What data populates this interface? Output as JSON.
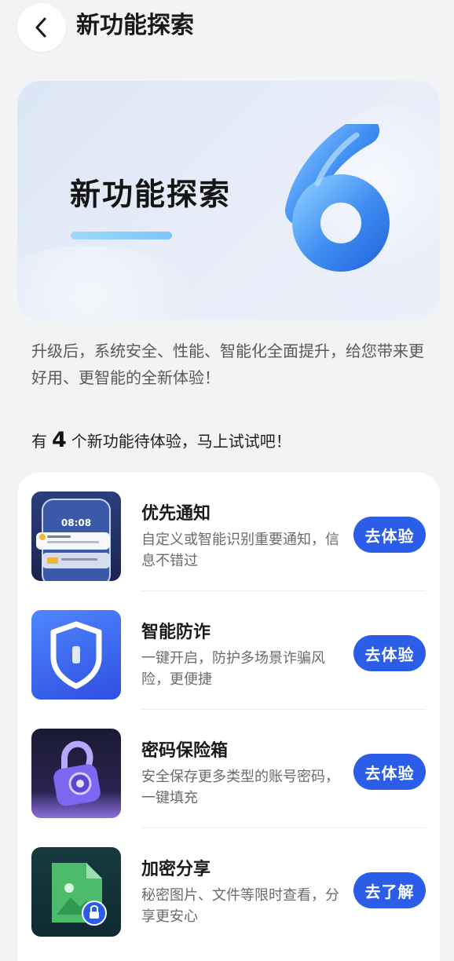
{
  "header": {
    "title": "新功能探索"
  },
  "banner": {
    "title": "新功能探索"
  },
  "intro": "升级后，系统安全、性能、智能化全面提升，给您带来更好用、更智能的全新体验！",
  "count_line": {
    "prefix": "有",
    "count": "4",
    "suffix": "个新功能待体验，马上试试吧！"
  },
  "features": [
    {
      "title": "优先通知",
      "description": "自定义或智能识别重要通知，信息不错过",
      "button": "去体验",
      "icon": "priority-notification-thumbnail",
      "thumb_time": "08:08"
    },
    {
      "title": "智能防诈",
      "description": "一键开启，防护多场景诈骗风险，更便捷",
      "button": "去体验",
      "icon": "shield-icon"
    },
    {
      "title": "密码保险箱",
      "description": "安全保存更多类型的账号密码，一键填充",
      "button": "去体验",
      "icon": "padlock-icon"
    },
    {
      "title": "加密分享",
      "description": "秘密图片、文件等限时查看，分享更安心",
      "button": "去了解",
      "icon": "encrypted-file-icon"
    }
  ],
  "colors": {
    "accent": "#2b5de8",
    "background": "#f1f3f5"
  }
}
